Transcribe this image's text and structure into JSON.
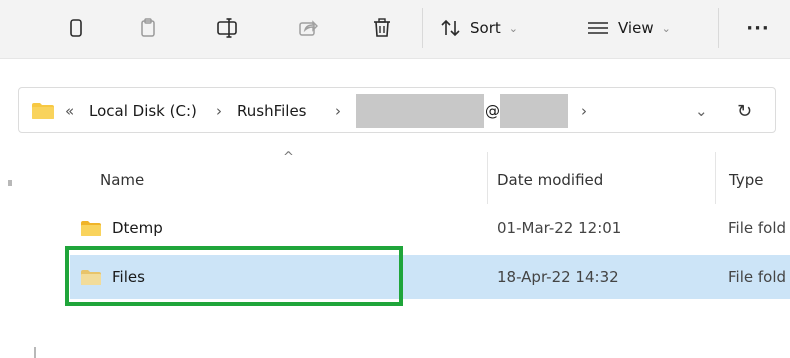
{
  "toolbar": {
    "sort_label": "Sort",
    "view_label": "View",
    "more_label": "···",
    "caret": "⌄"
  },
  "address": {
    "prefix": "«",
    "crumbs": [
      "Local Disk (C:)",
      "RushFiles"
    ],
    "redacted_suffix": "@",
    "separator": "›",
    "dropdown": "⌄",
    "refresh": "↻"
  },
  "columns": {
    "name": "Name",
    "date_modified": "Date modified",
    "type": "Type",
    "sort_indicator": "^"
  },
  "files": [
    {
      "name": "Dtemp",
      "date": "01-Mar-22 12:01",
      "type": "File fold",
      "selected": false
    },
    {
      "name": "Files",
      "date": "18-Apr-22 14:32",
      "type": "File fold",
      "selected": true
    }
  ],
  "colors": {
    "folder": "#f7c843",
    "selection": "#cce4f7",
    "highlight": "#1fa53a"
  }
}
